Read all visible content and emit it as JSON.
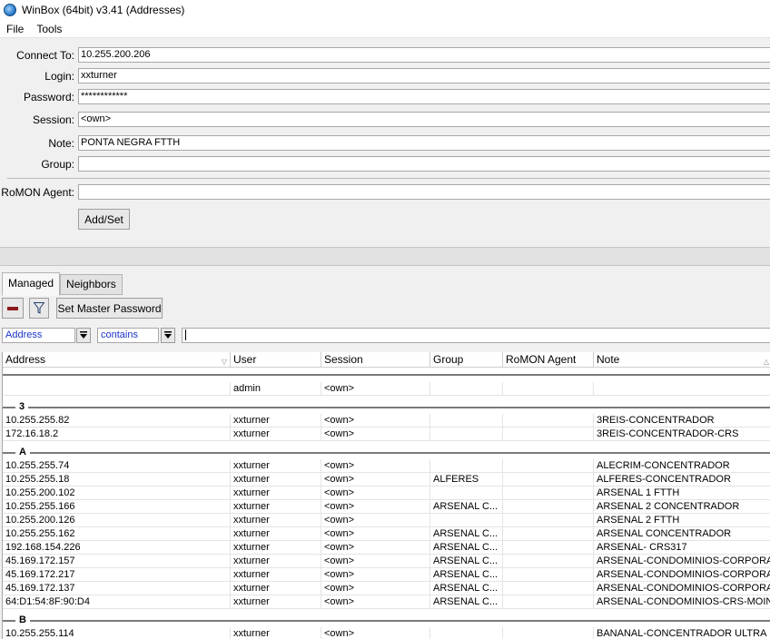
{
  "window": {
    "title": "WinBox (64bit) v3.41 (Addresses)"
  },
  "menu": {
    "file": "File",
    "tools": "Tools"
  },
  "form": {
    "connect_to_label": "Connect To:",
    "connect_to_value": "10.255.200.206",
    "login_label": "Login:",
    "login_value": "xxturner",
    "password_label": "Password:",
    "password_value": "************",
    "session_label": "Session:",
    "session_value": "<own>",
    "note_label": "Note:",
    "note_value": "PONTA NEGRA FTTH",
    "group_label": "Group:",
    "group_value": "",
    "romon_label": "RoMON Agent:",
    "romon_value": "",
    "add_set_label": "Add/Set"
  },
  "tabs": {
    "managed": "Managed",
    "neighbors": "Neighbors"
  },
  "toolbar": {
    "set_master_password": "Set Master Password",
    "remove_icon": "minus-icon",
    "filter_icon": "funnel-icon"
  },
  "filter": {
    "field": "Address",
    "operator": "contains",
    "text": ""
  },
  "table": {
    "columns": [
      "Address",
      "User",
      "Session",
      "Group",
      "RoMON Agent",
      "Note"
    ],
    "ungrouped": [
      {
        "address": "",
        "user": "admin",
        "session": "<own>",
        "group": "",
        "romon": "",
        "note": ""
      }
    ],
    "groups": [
      {
        "label": "3",
        "rows": [
          {
            "address": "10.255.255.82",
            "user": "xxturner",
            "session": "<own>",
            "group": "",
            "romon": "",
            "note": "3REIS-CONCENTRADOR"
          },
          {
            "address": "172.16.18.2",
            "user": "xxturner",
            "session": "<own>",
            "group": "",
            "romon": "",
            "note": "3REIS-CONCENTRADOR-CRS"
          }
        ]
      },
      {
        "label": "A",
        "rows": [
          {
            "address": "10.255.255.74",
            "user": "xxturner",
            "session": "<own>",
            "group": "",
            "romon": "",
            "note": "ALECRIM-CONCENTRADOR"
          },
          {
            "address": "10.255.255.18",
            "user": "xxturner",
            "session": "<own>",
            "group": "ALFERES",
            "romon": "",
            "note": "ALFERES-CONCENTRADOR"
          },
          {
            "address": "10.255.200.102",
            "user": "xxturner",
            "session": "<own>",
            "group": "",
            "romon": "",
            "note": "ARSENAL 1 FTTH"
          },
          {
            "address": "10.255.255.166",
            "user": "xxturner",
            "session": "<own>",
            "group": "ARSENAL C...",
            "romon": "",
            "note": "ARSENAL 2 CONCENTRADOR"
          },
          {
            "address": "10.255.200.126",
            "user": "xxturner",
            "session": "<own>",
            "group": "",
            "romon": "",
            "note": "ARSENAL 2 FTTH"
          },
          {
            "address": "10.255.255.162",
            "user": "xxturner",
            "session": "<own>",
            "group": "ARSENAL C...",
            "romon": "",
            "note": "ARSENAL CONCENTRADOR"
          },
          {
            "address": "192.168.154.226",
            "user": "xxturner",
            "session": "<own>",
            "group": "ARSENAL C...",
            "romon": "",
            "note": "ARSENAL- CRS317"
          },
          {
            "address": "45.169.172.157",
            "user": "xxturner",
            "session": "<own>",
            "group": "ARSENAL C...",
            "romon": "",
            "note": "ARSENAL-CONDOMINIOS-CORPORA..."
          },
          {
            "address": "45.169.172.217",
            "user": "xxturner",
            "session": "<own>",
            "group": "ARSENAL C...",
            "romon": "",
            "note": "ARSENAL-CONDOMINIOS-CORPORA..."
          },
          {
            "address": "45.169.172.137",
            "user": "xxturner",
            "session": "<own>",
            "group": "ARSENAL C...",
            "romon": "",
            "note": "ARSENAL-CONDOMINIOS-CORPORA..."
          },
          {
            "address": "64:D1:54:8F:90:D4",
            "user": "xxturner",
            "session": "<own>",
            "group": "ARSENAL C...",
            "romon": "",
            "note": "ARSENAL-CONDOMINIOS-CRS-MOIN..."
          }
        ]
      },
      {
        "label": "B",
        "rows": [
          {
            "address": "10.255.255.114",
            "user": "xxturner",
            "session": "<own>",
            "group": "",
            "romon": "",
            "note": "BANANAL-CONCENTRADOR ULTRA"
          }
        ]
      }
    ]
  }
}
